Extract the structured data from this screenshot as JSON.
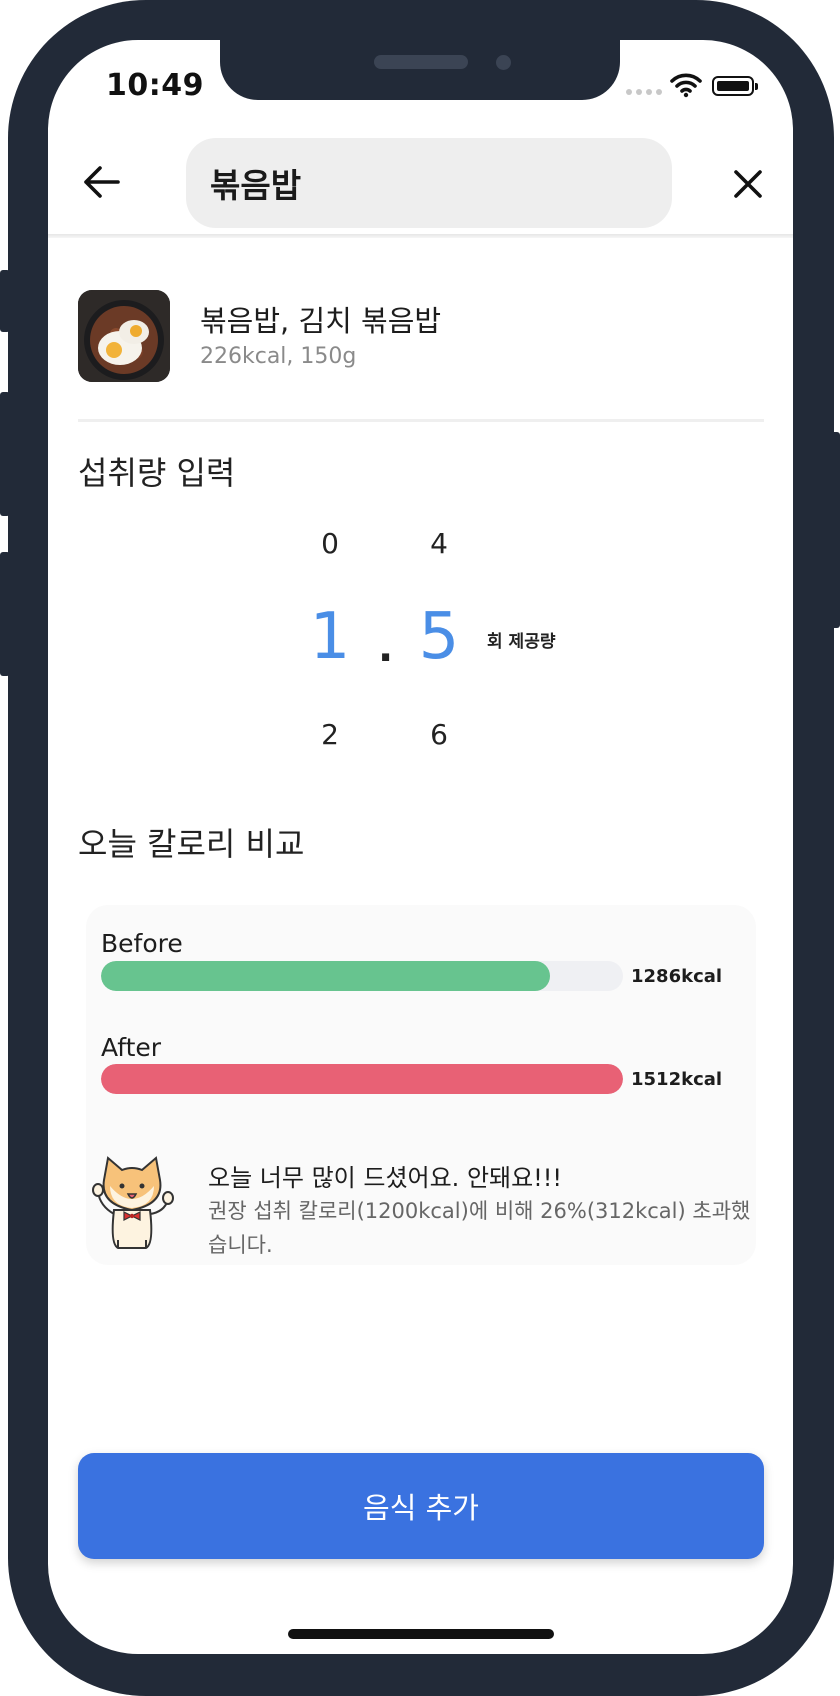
{
  "status_bar": {
    "time": "10:49"
  },
  "header": {
    "back_icon": "arrow-left-icon",
    "search_value": "볶음밥",
    "close_icon": "close-icon"
  },
  "food": {
    "name": "볶음밥, 김치 볶음밥",
    "meta": "226kcal, 150g"
  },
  "intake": {
    "title": "섭취량 입력",
    "integer_above": "0",
    "integer_selected": "1",
    "integer_below": "2",
    "separator": ".",
    "decimal_above": "4",
    "decimal_selected": "5",
    "decimal_below": "6",
    "unit": "회 제공량"
  },
  "comparison": {
    "title": "오늘 칼로리 비교",
    "before": {
      "label": "Before",
      "value": "1286kcal",
      "fraction": 0.86,
      "color": "#67c48f"
    },
    "after": {
      "label": "After",
      "value": "1512kcal",
      "fraction": 1.0,
      "color": "#e86175"
    },
    "message_title": "오늘 너무 많이 드셨어요. 안돼요!!!",
    "message_body": "권장 섭취 칼로리(1200kcal)에 비해 26%(312kcal) 초과했습니다.",
    "mascot_icon": "cat-mascot-icon"
  },
  "action": {
    "add_label": "음식 추가"
  },
  "colors": {
    "accent": "#3a72e0",
    "picker_selected": "#4a8ee6",
    "frame": "#222a38"
  }
}
